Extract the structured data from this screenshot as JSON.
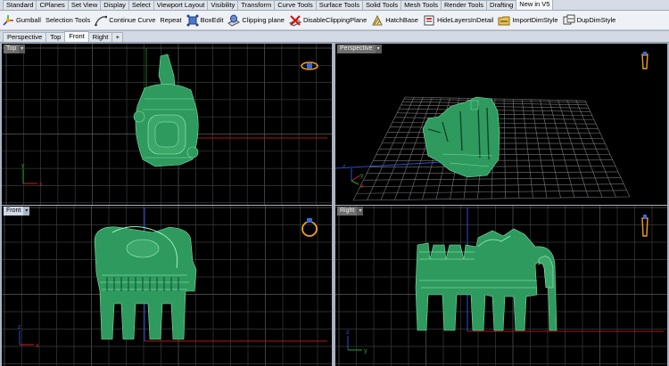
{
  "tabs": [
    {
      "label": "Standard",
      "active": false
    },
    {
      "label": "CPlanes",
      "active": false
    },
    {
      "label": "Set View",
      "active": false
    },
    {
      "label": "Display",
      "active": false
    },
    {
      "label": "Select",
      "active": false
    },
    {
      "label": "Viewport Layout",
      "active": false
    },
    {
      "label": "Visibility",
      "active": false
    },
    {
      "label": "Transform",
      "active": false
    },
    {
      "label": "Curve Tools",
      "active": false
    },
    {
      "label": "Surface Tools",
      "active": false
    },
    {
      "label": "Solid Tools",
      "active": false
    },
    {
      "label": "Mesh Tools",
      "active": false
    },
    {
      "label": "Render Tools",
      "active": false
    },
    {
      "label": "Drafting",
      "active": false
    },
    {
      "label": "New in V5",
      "active": true
    }
  ],
  "toolbar": [
    {
      "label": "Gumball",
      "icon": "gumball-icon"
    },
    {
      "label": "Selection Tools",
      "icon": "selection-icon"
    },
    {
      "label": "Continue Curve",
      "icon": "continue-curve-icon"
    },
    {
      "label": "Repeat",
      "icon": "repeat-icon"
    },
    {
      "label": "BoxEdit",
      "icon": "boxedit-icon"
    },
    {
      "label": "Clipping plane",
      "icon": "clipping-plane-icon"
    },
    {
      "label": "DisableClippingPlane",
      "icon": "disable-clipping-icon"
    },
    {
      "label": "HatchBase",
      "icon": "hatch-icon"
    },
    {
      "label": "HideLayersInDetail",
      "icon": "hide-layers-icon"
    },
    {
      "label": "ImportDimStyle",
      "icon": "import-dimstyle-icon"
    },
    {
      "label": "DupDimStyle",
      "icon": "dup-dimstyle-icon"
    }
  ],
  "view_tabs": [
    {
      "label": "Perspective",
      "active": false
    },
    {
      "label": "Top",
      "active": false
    },
    {
      "label": "Front",
      "active": true
    },
    {
      "label": "Right",
      "active": false
    }
  ],
  "view_tab_add": "+",
  "viewports": {
    "top": {
      "label": "Top",
      "dropdown": "▾"
    },
    "perspective": {
      "label": "Perspective",
      "dropdown": "▾"
    },
    "front": {
      "label": "Front",
      "dropdown": "▾"
    },
    "right": {
      "label": "Right",
      "dropdown": "▾"
    }
  },
  "axis_labels": {
    "x": "x",
    "y": "y",
    "z": "z"
  },
  "colors": {
    "viewport_bg": "#000000",
    "grid": "#3a3a3a",
    "grid_major": "#5c5c5c",
    "x_axis": "#b0141a",
    "y_axis": "#1a7a18",
    "model": "#2e9a5e",
    "model_edge": "#7fe0a8",
    "ring_icon": "#f0a020"
  }
}
